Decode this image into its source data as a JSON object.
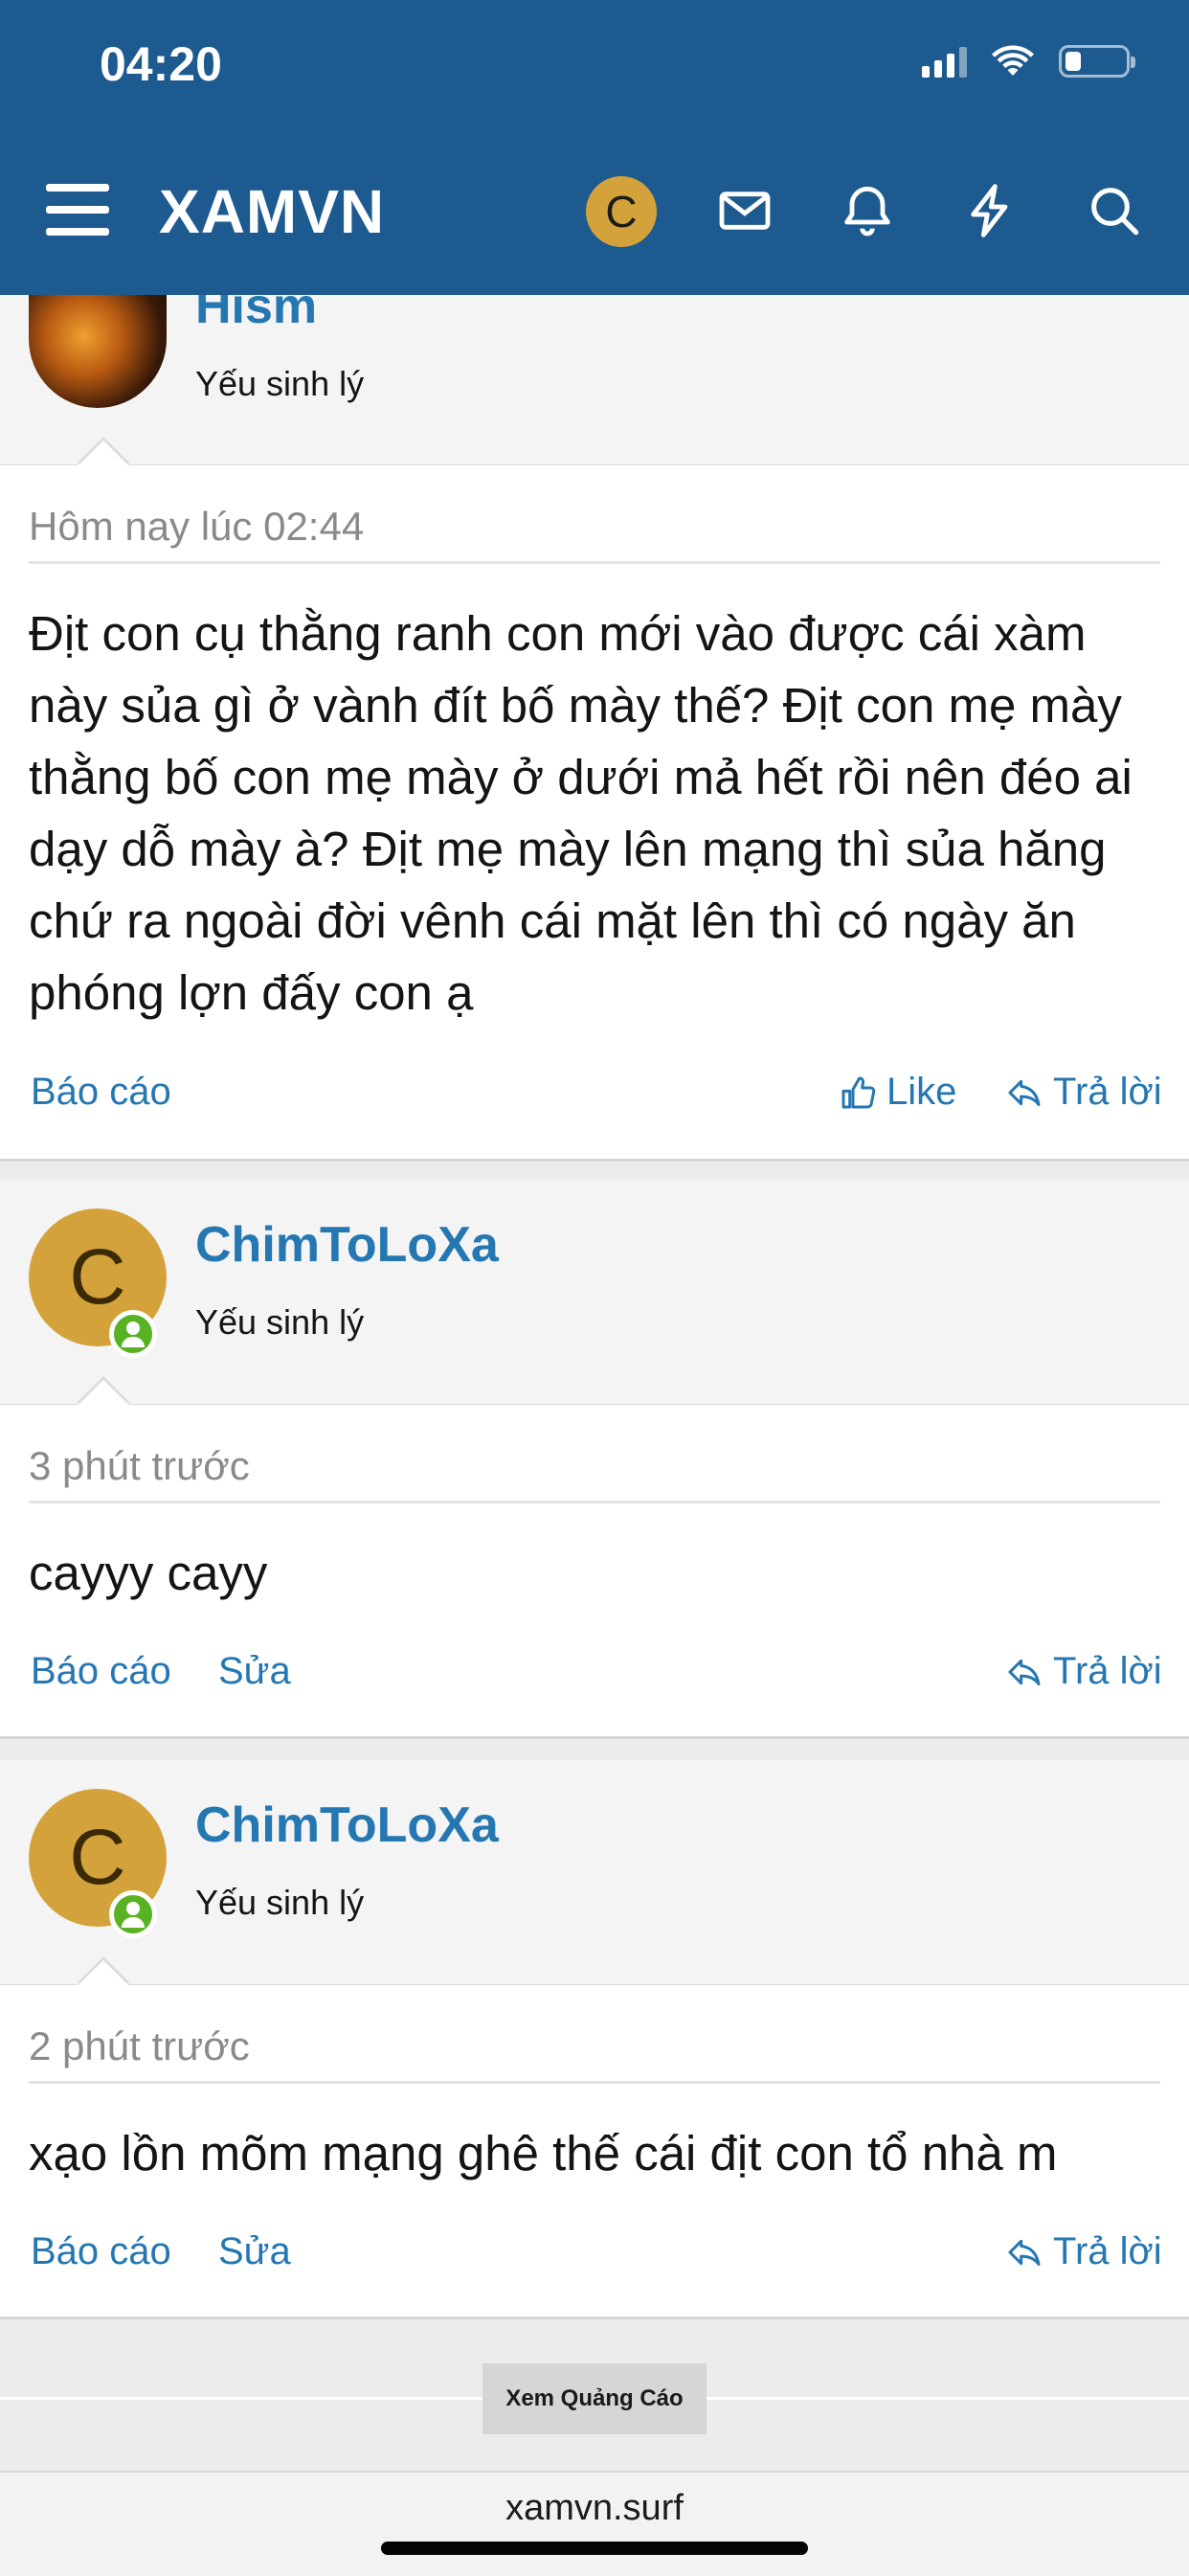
{
  "status_bar": {
    "time": "04:20"
  },
  "nav": {
    "logo": "XAMVN",
    "avatar_letter": "C"
  },
  "colors": {
    "header_bg": "#1d5a8f",
    "link": "#2577b1",
    "avatar_bg": "#d4a23a",
    "online": "#59b224"
  },
  "posts": [
    {
      "username": "Hism",
      "user_title": "Yếu sinh lý",
      "date": "Hôm nay lúc 02:44",
      "message": "Địt con cụ thằng ranh con mới vào được cái xàm này sủa gì ở vành đít bố mày thế? Địt con mẹ mày thằng bố con mẹ mày ở dưới mả hết rồi nên đéo ai dạy dỗ mày à? Địt mẹ mày lên mạng thì sủa hăng chứ ra ngoài đời vênh cái mặt lên thì có ngày ăn phóng lợn đấy con ạ",
      "actions": {
        "report": "Báo cáo",
        "like": "Like",
        "reply": "Trả lời"
      }
    },
    {
      "username": "ChimToLoXa",
      "avatar_letter": "C",
      "user_title": "Yếu sinh lý",
      "date": "3 phút trước",
      "message": "cayyy cayy",
      "actions": {
        "report": "Báo cáo",
        "edit": "Sửa",
        "reply": "Trả lời"
      }
    },
    {
      "username": "ChimToLoXa",
      "avatar_letter": "C",
      "user_title": "Yếu sinh lý",
      "date": "2 phút trước",
      "message": "xạo lồn mõm mạng ghê thế cái địt con tổ nhà m",
      "actions": {
        "report": "Báo cáo",
        "edit": "Sửa",
        "reply": "Trả lời"
      }
    }
  ],
  "ad": {
    "label": "Xem Quảng Cáo"
  },
  "browser": {
    "url": "xamvn.surf"
  }
}
